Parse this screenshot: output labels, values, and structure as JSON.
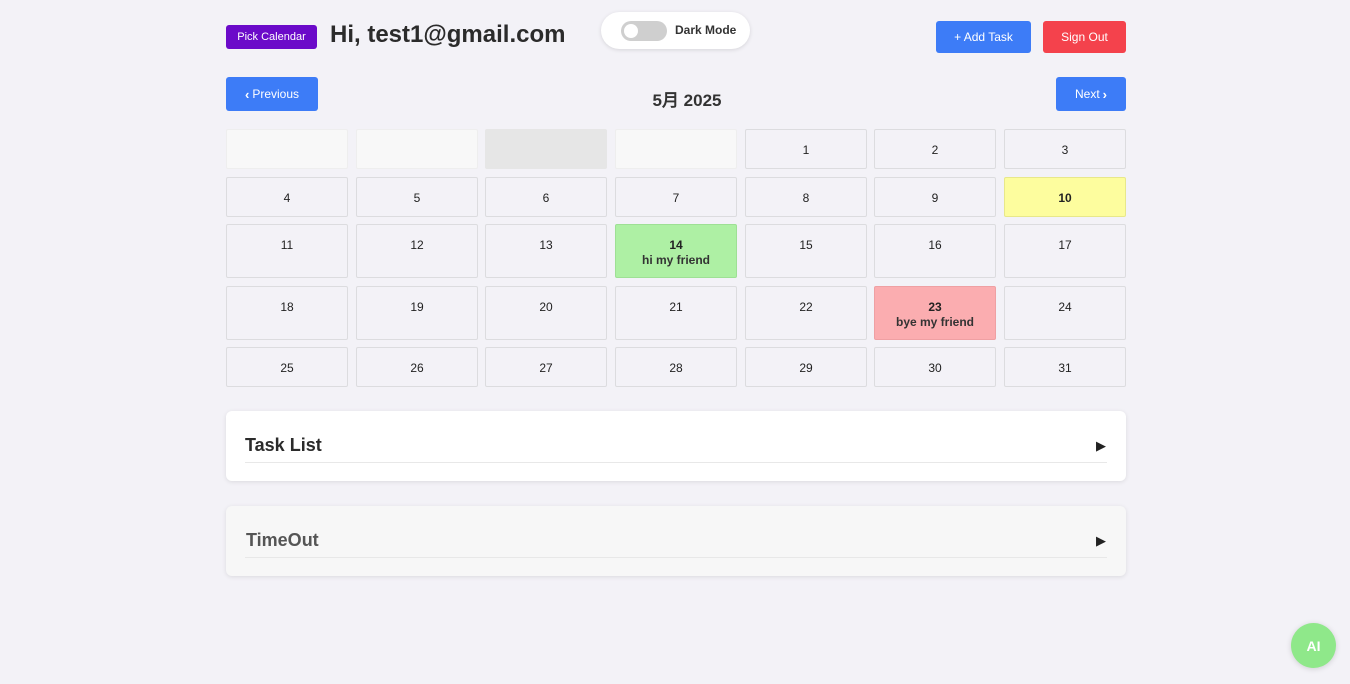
{
  "header": {
    "pick_calendar_label": "Pick Calendar",
    "greeting": "Hi, test1@gmail.com",
    "dark_mode_label": "Dark Mode",
    "add_task_label": "+ Add Task",
    "sign_out_label": "Sign Out"
  },
  "nav": {
    "previous_label": "Previous",
    "next_label": "Next",
    "month_title": "5月 2025"
  },
  "calendar": {
    "days": [
      {
        "n": "1"
      },
      {
        "n": "2"
      },
      {
        "n": "3"
      },
      {
        "n": "4"
      },
      {
        "n": "5"
      },
      {
        "n": "6"
      },
      {
        "n": "7"
      },
      {
        "n": "8"
      },
      {
        "n": "9"
      },
      {
        "n": "10"
      },
      {
        "n": "11"
      },
      {
        "n": "12"
      },
      {
        "n": "13"
      },
      {
        "n": "14",
        "task": "hi my friend"
      },
      {
        "n": "15"
      },
      {
        "n": "16"
      },
      {
        "n": "17"
      },
      {
        "n": "18"
      },
      {
        "n": "19"
      },
      {
        "n": "20"
      },
      {
        "n": "21"
      },
      {
        "n": "22"
      },
      {
        "n": "23",
        "task": "bye my friend"
      },
      {
        "n": "24"
      },
      {
        "n": "25"
      },
      {
        "n": "26"
      },
      {
        "n": "27"
      },
      {
        "n": "28"
      },
      {
        "n": "29"
      },
      {
        "n": "30"
      },
      {
        "n": "31"
      }
    ]
  },
  "panels": {
    "task_list_title": "Task List",
    "timeout_title": "TimeOut",
    "arrow": "▶"
  },
  "ai_button_label": "AI",
  "colors": {
    "primary": "#3d7cf7",
    "danger": "#f4424c",
    "pick_calendar": "#6b0ac9",
    "today": "#fdfd9e",
    "task_green": "#aef0a4",
    "task_red": "#fbadb0",
    "ai": "#8fe88a"
  }
}
